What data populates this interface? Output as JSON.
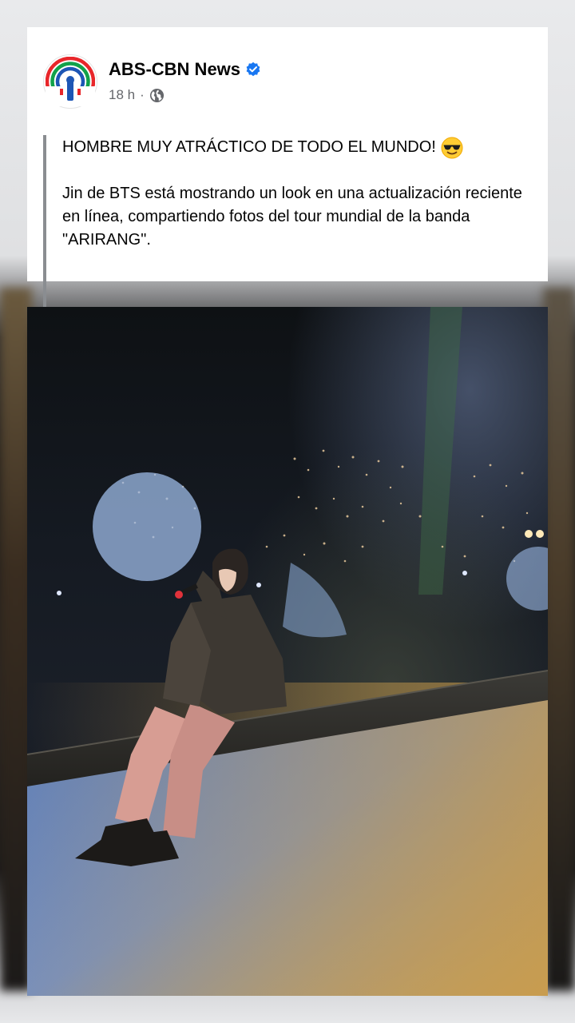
{
  "post": {
    "page_name": "ABS-CBN News",
    "timestamp": "18 h",
    "separator": "·",
    "audience_icon": "globe-icon",
    "verified_icon": "verified-badge-icon",
    "headline": "HOMBRE MUY ATRÁCTICO DE TODO EL MUNDO!",
    "headline_emoji": "smiling-face-with-sunglasses-emoji",
    "body": "Jin de BTS está mostrando un look en una actualización reciente en línea, compartiendo fotos del tour mundial de la banda \"ARIRANG\"."
  },
  "colors": {
    "verified_blue": "#1877f2",
    "meta_gray": "#65676b",
    "text": "#050505",
    "quote_bar": "#8a8d91"
  },
  "photo": {
    "subject": "performer-seated-on-stage-photo"
  }
}
